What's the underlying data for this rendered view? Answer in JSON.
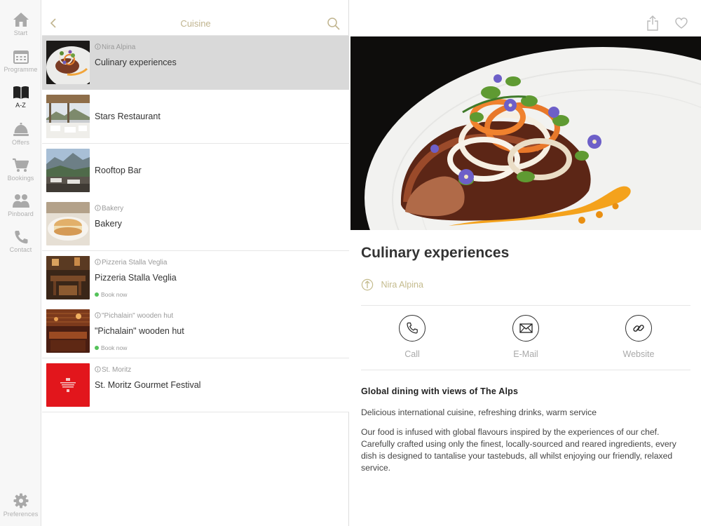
{
  "nav": {
    "items": [
      {
        "label": "Start",
        "icon": "home-icon",
        "active": false
      },
      {
        "label": "Programme",
        "icon": "calendar-icon",
        "active": false
      },
      {
        "label": "A-Z",
        "icon": "book-icon",
        "active": true
      },
      {
        "label": "Offers",
        "icon": "service-bell-icon",
        "active": false
      },
      {
        "label": "Bookings",
        "icon": "cart-icon",
        "active": false
      },
      {
        "label": "Pinboard",
        "icon": "people-icon",
        "active": false
      },
      {
        "label": "Contact",
        "icon": "phone-icon",
        "active": false
      }
    ],
    "preferences": {
      "label": "Preferences",
      "icon": "gear-icon"
    }
  },
  "list": {
    "title": "Cuisine",
    "items": [
      {
        "kicker": "Nira Alpina",
        "title": "Culinary experiences",
        "book": "",
        "selected": true
      },
      {
        "kicker": "",
        "title": "Stars Restaurant",
        "book": ""
      },
      {
        "kicker": "",
        "title": "Rooftop Bar",
        "book": ""
      },
      {
        "kicker": "Bakery",
        "title": "Bakery",
        "book": ""
      },
      {
        "kicker": "Pizzeria Stalla Veglia",
        "title": "Pizzeria Stalla Veglia",
        "book": "Book now"
      },
      {
        "kicker": "\"Pichalain\" wooden hut",
        "title": "\"Pichalain\" wooden hut",
        "book": "Book now"
      },
      {
        "kicker": "St. Moritz",
        "title": "St. Moritz Gourmet Festival",
        "book": ""
      }
    ]
  },
  "detail": {
    "title": "Culinary experiences",
    "location": "Nira Alpina",
    "actions": [
      {
        "label": "Call",
        "icon": "phone-icon"
      },
      {
        "label": "E-Mail",
        "icon": "envelope-icon"
      },
      {
        "label": "Website",
        "icon": "link-icon"
      }
    ],
    "section_title": "Global dining with views of The Alps",
    "paragraphs": [
      "Delicious international cuisine, refreshing drinks, warm service",
      "Our food is infused with global flavours inspired by the experiences of our chef. Carefully crafted using only the finest, locally-sourced and reared ingredients, every dish is designed to tantalise your tastebuds, all whilst enjoying our friendly, relaxed service."
    ]
  },
  "colors": {
    "accent_gold": "#c0b48e",
    "selected_row": "#d9d9d9",
    "book_dot": "#54c25a",
    "festival_red": "#e2161c"
  }
}
